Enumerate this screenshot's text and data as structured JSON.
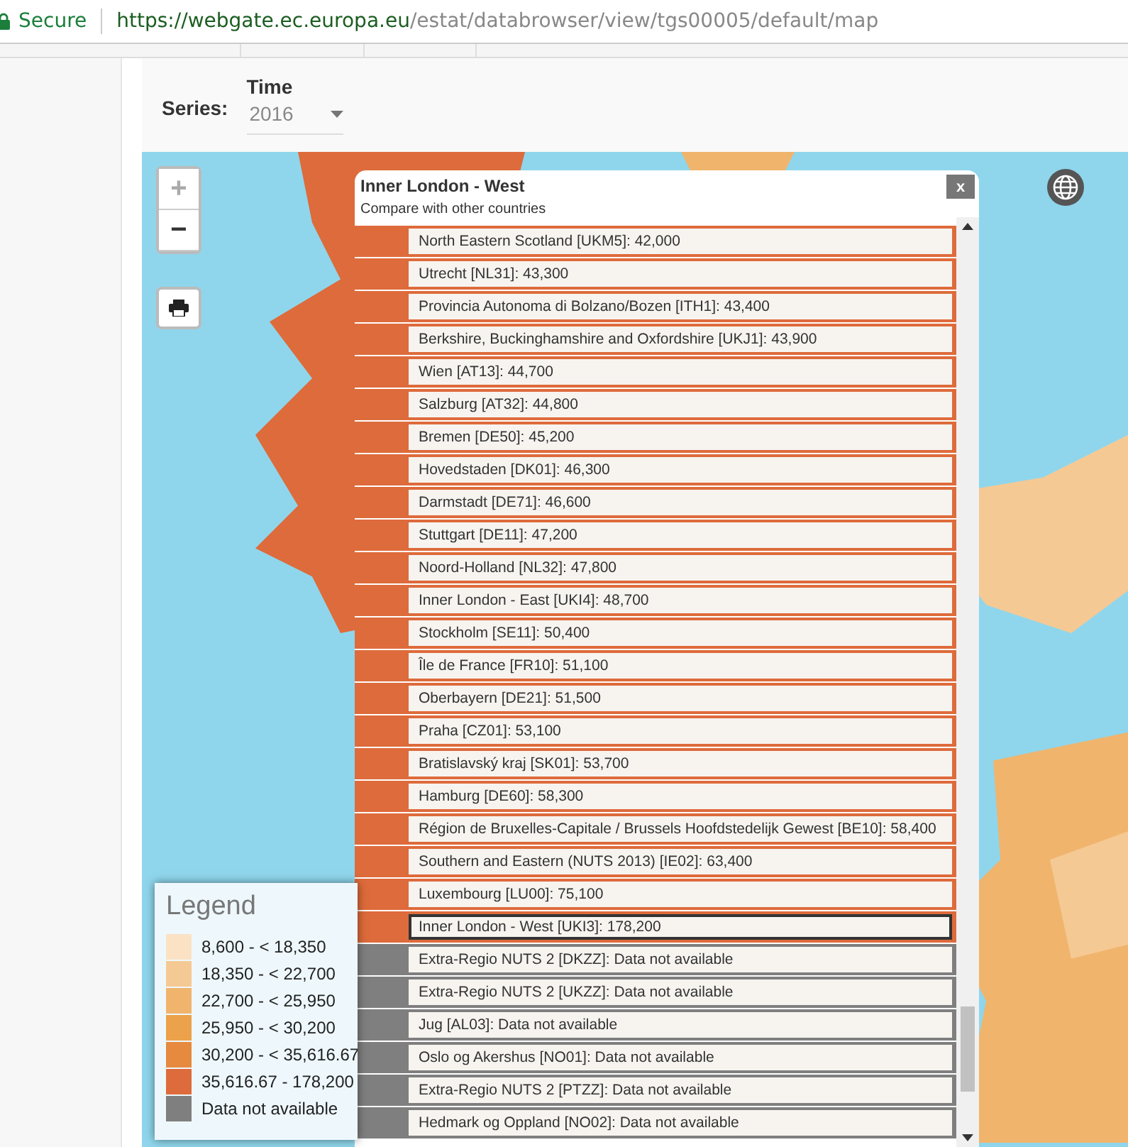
{
  "browser": {
    "secure_label": "Secure",
    "url_host": "https://webgate.ec.europa.eu",
    "url_path": "/estat/databrowser/view/tgs00005/default/map"
  },
  "series": {
    "label": "Series:",
    "time_label": "Time",
    "time_value": "2016"
  },
  "map": {
    "zoom_in": "+",
    "zoom_out": "−"
  },
  "popup": {
    "title": "Inner London - West",
    "close": "x",
    "subtitle": "Compare with other countries",
    "rows": [
      {
        "text": "North Eastern Scotland [UKM5]: 42,000",
        "color": "#de6b3b",
        "selected": false
      },
      {
        "text": "Utrecht [NL31]: 43,300",
        "color": "#de6b3b",
        "selected": false
      },
      {
        "text": "Provincia Autonoma di Bolzano/Bozen [ITH1]: 43,400",
        "color": "#de6b3b",
        "selected": false
      },
      {
        "text": "Berkshire, Buckinghamshire and Oxfordshire [UKJ1]: 43,900",
        "color": "#de6b3b",
        "selected": false
      },
      {
        "text": "Wien [AT13]: 44,700",
        "color": "#de6b3b",
        "selected": false
      },
      {
        "text": "Salzburg [AT32]: 44,800",
        "color": "#de6b3b",
        "selected": false
      },
      {
        "text": "Bremen [DE50]: 45,200",
        "color": "#de6b3b",
        "selected": false
      },
      {
        "text": "Hovedstaden [DK01]: 46,300",
        "color": "#de6b3b",
        "selected": false
      },
      {
        "text": "Darmstadt [DE71]: 46,600",
        "color": "#de6b3b",
        "selected": false
      },
      {
        "text": "Stuttgart [DE11]: 47,200",
        "color": "#de6b3b",
        "selected": false
      },
      {
        "text": "Noord-Holland [NL32]: 47,800",
        "color": "#de6b3b",
        "selected": false
      },
      {
        "text": "Inner London - East [UKI4]: 48,700",
        "color": "#de6b3b",
        "selected": false
      },
      {
        "text": "Stockholm [SE11]: 50,400",
        "color": "#de6b3b",
        "selected": false
      },
      {
        "text": "Île de France [FR10]: 51,100",
        "color": "#de6b3b",
        "selected": false
      },
      {
        "text": "Oberbayern [DE21]: 51,500",
        "color": "#de6b3b",
        "selected": false
      },
      {
        "text": "Praha [CZ01]: 53,100",
        "color": "#de6b3b",
        "selected": false
      },
      {
        "text": "Bratislavský kraj [SK01]: 53,700",
        "color": "#de6b3b",
        "selected": false
      },
      {
        "text": "Hamburg [DE60]: 58,300",
        "color": "#de6b3b",
        "selected": false
      },
      {
        "text": "Région de Bruxelles-Capitale / Brussels Hoofdstedelijk Gewest [BE10]: 58,400",
        "color": "#de6b3b",
        "selected": false
      },
      {
        "text": "Southern and Eastern (NUTS 2013) [IE02]: 63,400",
        "color": "#de6b3b",
        "selected": false
      },
      {
        "text": "Luxembourg [LU00]: 75,100",
        "color": "#de6b3b",
        "selected": false
      },
      {
        "text": "Inner London - West [UKI3]: 178,200",
        "color": "#de6b3b",
        "selected": true
      },
      {
        "text": "Extra-Regio NUTS 2 [DKZZ]: Data not available",
        "color": "#7f7f7f",
        "selected": false
      },
      {
        "text": "Extra-Regio NUTS 2 [UKZZ]: Data not available",
        "color": "#7f7f7f",
        "selected": false
      },
      {
        "text": "Jug [AL03]: Data not available",
        "color": "#7f7f7f",
        "selected": false
      },
      {
        "text": "Oslo og Akershus [NO01]: Data not available",
        "color": "#7f7f7f",
        "selected": false
      },
      {
        "text": "Extra-Regio NUTS 2 [PTZZ]: Data not available",
        "color": "#7f7f7f",
        "selected": false
      },
      {
        "text": "Hedmark og Oppland [NO02]: Data not available",
        "color": "#7f7f7f",
        "selected": false
      }
    ]
  },
  "legend": {
    "title": "Legend",
    "items": [
      {
        "label": "8,600 - < 18,350",
        "color": "#fbe2c4"
      },
      {
        "label": "18,350 - < 22,700",
        "color": "#f5c994"
      },
      {
        "label": "22,700 - < 25,950",
        "color": "#f0b46d"
      },
      {
        "label": "25,950 - < 30,200",
        "color": "#eba24a"
      },
      {
        "label": "30,200 - < 35,616.67",
        "color": "#e58a3f"
      },
      {
        "label": "35,616.67 - 178,200",
        "color": "#de6b3b"
      },
      {
        "label": "Data not available",
        "color": "#7f7f7f"
      }
    ]
  }
}
